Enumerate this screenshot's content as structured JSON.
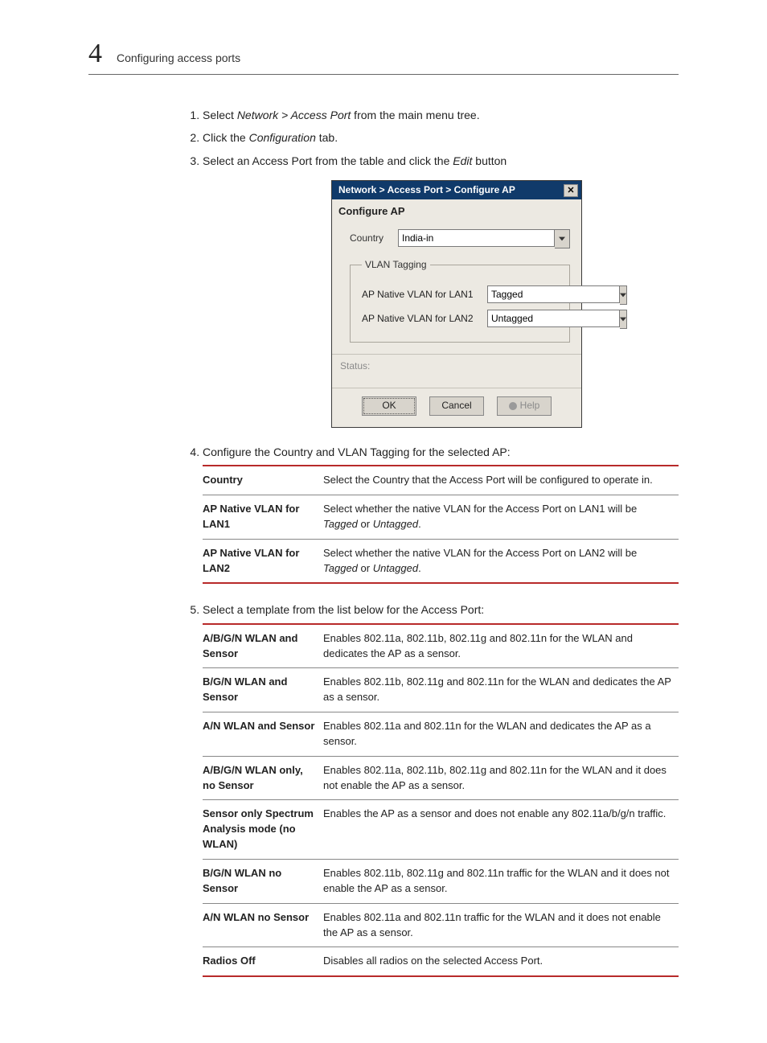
{
  "header": {
    "chapter_number": "4",
    "section_title": "Configuring access ports"
  },
  "steps": {
    "s1_a": "Select ",
    "s1_i": "Network > Access Port",
    "s1_b": " from the main menu tree.",
    "s2_a": "Click the ",
    "s2_i": "Configuration",
    "s2_b": " tab.",
    "s3_a": "Select an Access Port from the table and click the ",
    "s3_i": "Edit",
    "s3_b": " button",
    "s4": "Configure the Country and VLAN Tagging for the selected AP:",
    "s5": "Select a template from the list below for the Access Port:"
  },
  "dialog": {
    "title": "Network > Access Port > Configure AP",
    "subtitle": "Configure AP",
    "country_label": "Country",
    "country_value": "India-in",
    "vlan_legend": "VLAN Tagging",
    "lan1_label": "AP Native VLAN for LAN1",
    "lan1_value": "Tagged",
    "lan2_label": "AP Native VLAN for LAN2",
    "lan2_value": "Untagged",
    "status_label": "Status:",
    "ok": "OK",
    "cancel": "Cancel",
    "help": "Help"
  },
  "table1": [
    {
      "term": "Country",
      "desc": "Select the Country that the Access Port will be configured to operate in."
    },
    {
      "term": "AP Native VLAN for LAN1",
      "desc_a": "Select whether the native VLAN for the Access Port on LAN1 will be ",
      "i1": "Tagged",
      "mid": " or ",
      "i2": "Untagged",
      "end": "."
    },
    {
      "term": "AP Native VLAN for LAN2",
      "desc_a": "Select whether the native VLAN for the Access Port on LAN2 will be ",
      "i1": "Tagged",
      "mid": " or ",
      "i2": "Untagged",
      "end": "."
    }
  ],
  "table2": [
    {
      "term": "A/B/G/N WLAN and Sensor",
      "desc": "Enables 802.11a, 802.11b, 802.11g and 802.11n for the WLAN and dedicates the AP as a sensor."
    },
    {
      "term": "B/G/N WLAN and Sensor",
      "desc": "Enables 802.11b, 802.11g and 802.11n for the WLAN and dedicates the AP as a sensor."
    },
    {
      "term": "A/N WLAN and Sensor",
      "desc": "Enables 802.11a and 802.11n for the WLAN and dedicates the AP as a sensor."
    },
    {
      "term": "A/B/G/N WLAN only, no Sensor",
      "desc": "Enables 802.11a, 802.11b, 802.11g and 802.11n for the WLAN and it does not enable the AP as a sensor."
    },
    {
      "term": "Sensor only Spectrum Analysis mode (no WLAN)",
      "desc": "Enables the AP as a sensor and does not enable any 802.11a/b/g/n traffic."
    },
    {
      "term": "B/G/N WLAN no Sensor",
      "desc": "Enables 802.11b, 802.11g and 802.11n traffic for the WLAN and it does not enable the AP as a sensor."
    },
    {
      "term": "A/N WLAN no Sensor",
      "desc": "Enables 802.11a and 802.11n traffic for the WLAN and it does not enable the AP as a sensor."
    },
    {
      "term": "Radios Off",
      "desc": "Disables all radios on the selected Access Port."
    }
  ]
}
